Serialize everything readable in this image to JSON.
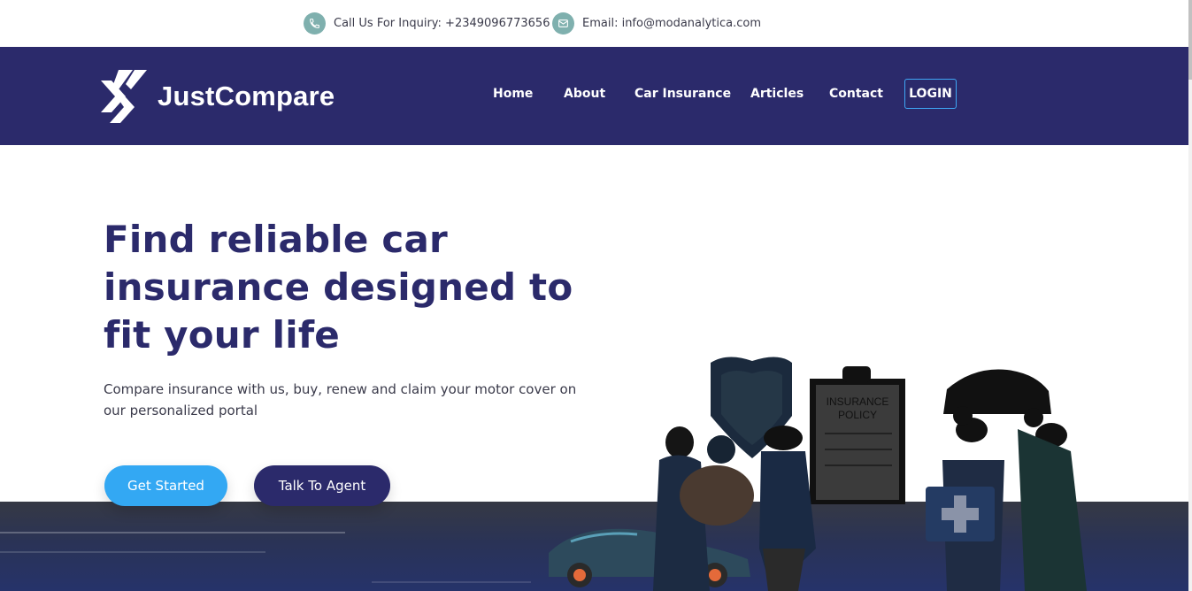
{
  "topbar": {
    "phone_text": "Call Us For Inquiry: +2349096773656",
    "email_text": "Email: info@modanalytica.com"
  },
  "header": {
    "logo_text": "JustCompare",
    "nav": [
      "Home",
      "About",
      "Car Insurance",
      "Articles",
      "Contact"
    ],
    "login_label": "LOGIN"
  },
  "hero": {
    "title": "Find reliable car insurance designed to fit your life",
    "subtitle": "Compare insurance with us, buy, renew and claim your motor cover on our personalized portal",
    "btn_start": "Get Started",
    "btn_agent": "Talk To Agent"
  },
  "illustration": {
    "clipboard_line1": "INSURANCE",
    "clipboard_line2": "POLICY"
  },
  "colors": {
    "brand_navy": "#2b2a6b",
    "accent_blue": "#33a8f3",
    "icon_teal": "#7fb0ae"
  },
  "icons": [
    "phone-icon",
    "mail-icon",
    "logo-icon"
  ]
}
